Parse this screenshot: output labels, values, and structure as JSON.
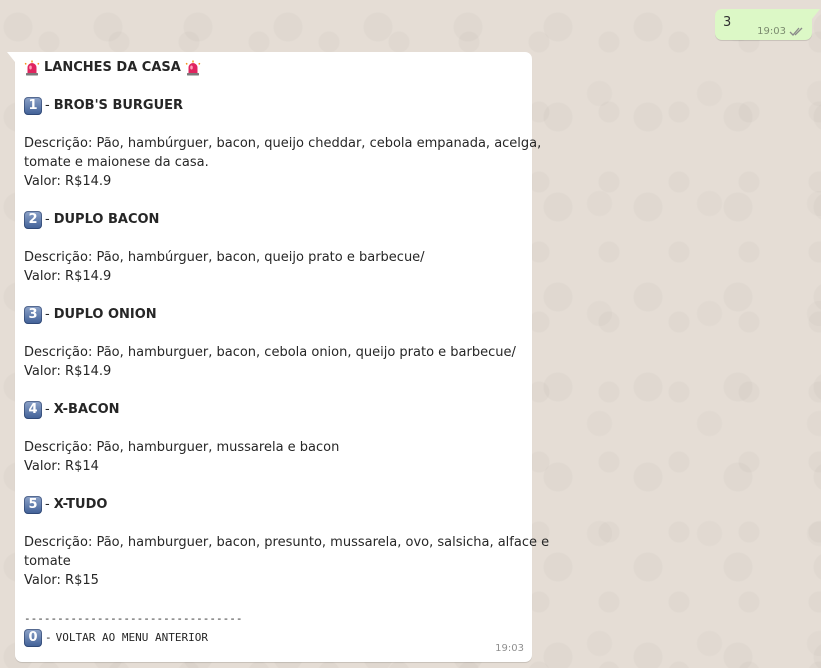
{
  "outgoing": {
    "text": "3",
    "time": "19:03",
    "status_icon": "double-check-icon"
  },
  "incoming": {
    "header": "LANCHES DA CASA",
    "header_icon": "siren-emoji",
    "items": [
      {
        "number": "1",
        "name": "BROB'S BURGUER",
        "desc_line1": "Descrição: Pão, hambúrguer, bacon, queijo cheddar, cebola empanada, acelga,",
        "desc_line2": "tomate e maionese da casa.",
        "price": "Valor: R$14.9"
      },
      {
        "number": "2",
        "name": "DUPLO BACON",
        "desc_line1": "Descrição: Pão, hambúrguer, bacon, queijo prato e barbecue/",
        "desc_line2": "",
        "price": "Valor: R$14.9"
      },
      {
        "number": "3",
        "name": "DUPLO ONION",
        "desc_line1": "Descrição: Pão, hamburguer, bacon, cebola onion, queijo prato e barbecue/",
        "desc_line2": "",
        "price": "Valor: R$14.9"
      },
      {
        "number": "4",
        "name": "X-BACON",
        "desc_line1": "Descrição: Pão, hamburguer, mussarela e bacon",
        "desc_line2": "",
        "price": "Valor: R$14"
      },
      {
        "number": "5",
        "name": "X-TUDO",
        "desc_line1": "Descrição: Pão, hamburguer, bacon, presunto, mussarela, ovo, salsicha, alface e",
        "desc_line2": "tomate",
        "price": "Valor: R$15"
      }
    ],
    "separator_label": "---------------------------------",
    "back_number": "0",
    "back_text": "VOLTAR AO MENU ANTERIOR",
    "time": "19:03"
  },
  "colors": {
    "background": "#e5ddd5",
    "outgoing_bubble": "#dcf8c6",
    "incoming_bubble": "#ffffff",
    "number_badge": "#4a6aa0"
  }
}
